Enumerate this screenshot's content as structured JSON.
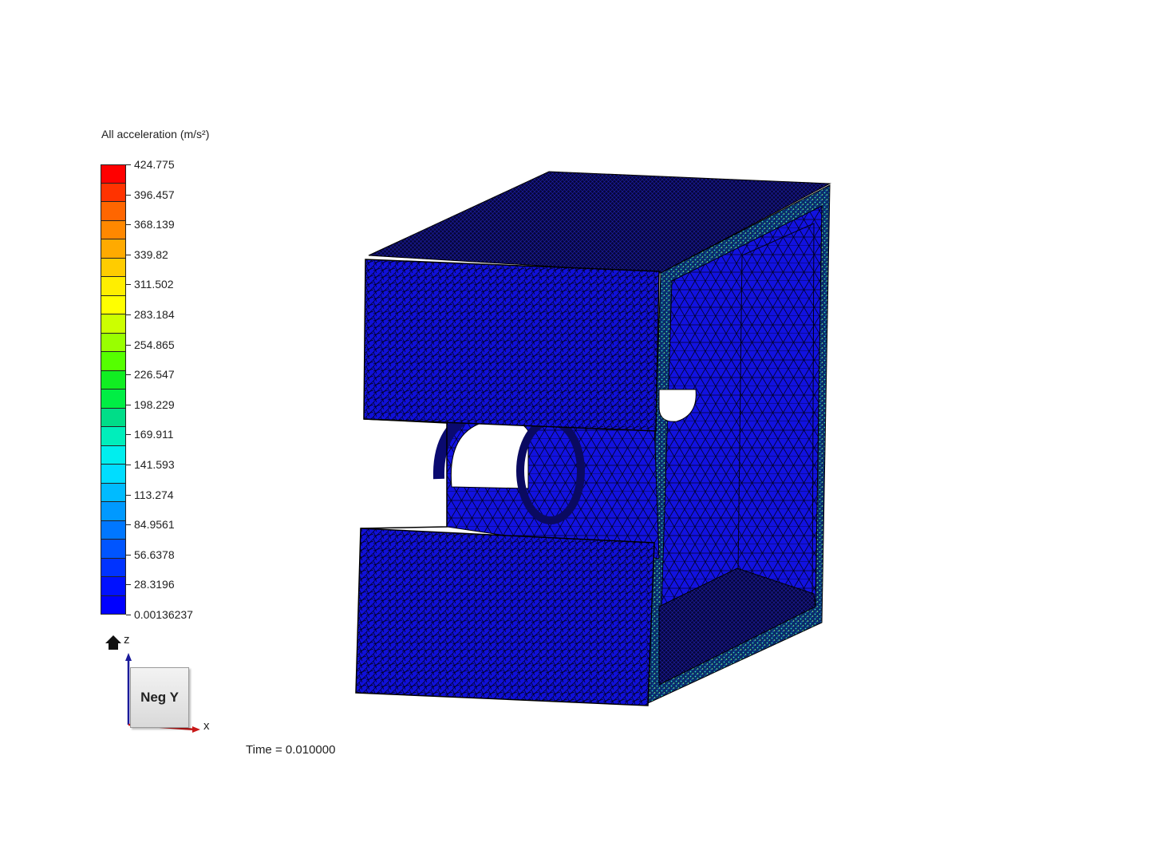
{
  "legend": {
    "title": "All acceleration (m/s²)",
    "ticks": [
      "424.775",
      "396.457",
      "368.139",
      "339.82",
      "311.502",
      "283.184",
      "254.865",
      "226.547",
      "198.229",
      "169.911",
      "141.593",
      "113.274",
      "84.9561",
      "56.6378",
      "28.3196",
      "0.00136237"
    ],
    "colors": [
      "#ff0000",
      "#ff3300",
      "#ff6600",
      "#ff8800",
      "#ffaa00",
      "#ffcc00",
      "#ffee00",
      "#ffff00",
      "#ccff00",
      "#99ff00",
      "#55ff00",
      "#11ee22",
      "#00ee44",
      "#00dd88",
      "#00eebb",
      "#00eeee",
      "#00ddff",
      "#00bbff",
      "#0099ff",
      "#0077ff",
      "#0055ff",
      "#0033ff",
      "#0011ff",
      "#0000ff"
    ]
  },
  "time_label": "Time = 0.010000",
  "orientation": {
    "cube_face": "Neg Y",
    "axis_z": "z",
    "axis_x": "x",
    "home_icon": "home-icon"
  },
  "mesh": {
    "base_color": "#1010d8",
    "edge_color": "#000000",
    "accent_color": "#00d0c0"
  }
}
